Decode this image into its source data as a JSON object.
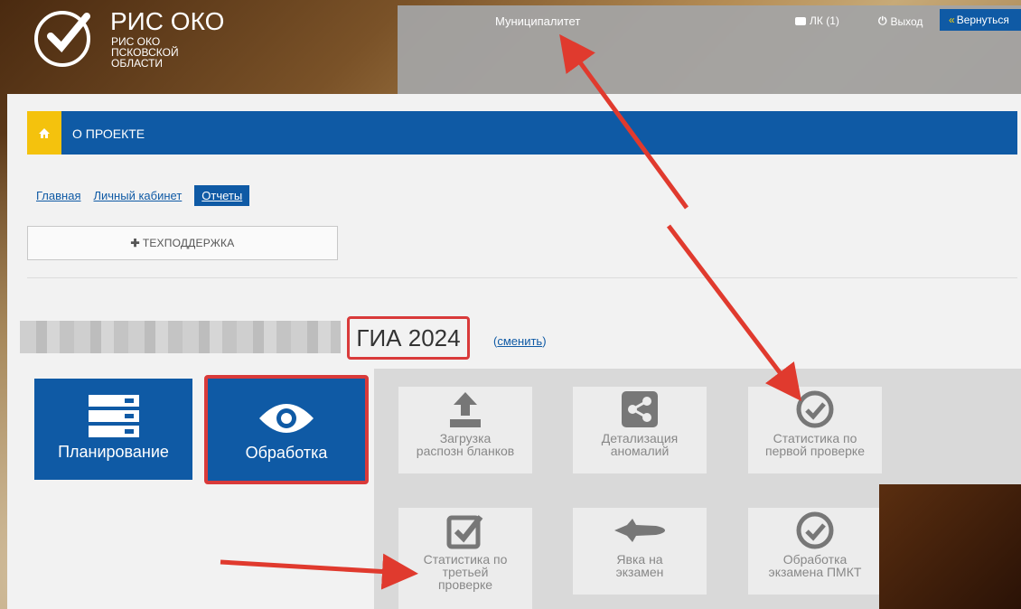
{
  "brand": {
    "title": "РИС ОКО",
    "sub_line1": "РИС ОКО",
    "sub_line2": "ПСКОВСКОЙ",
    "sub_line3": "ОБЛАСТИ"
  },
  "header": {
    "role": "Муниципалитет",
    "lk_label": "ЛК (1)",
    "exit_label": "Выход",
    "back_label": "Вернуться"
  },
  "menu": {
    "label": "О ПРОЕКТЕ"
  },
  "breadcrumbs": [
    {
      "label": "Главная"
    },
    {
      "label": "Личный кабинет"
    },
    {
      "label": "Отчеты"
    }
  ],
  "support": {
    "label": "ТЕХПОДДЕРЖКА"
  },
  "exam": {
    "name": "ГИА 2024",
    "change_link": "сменить"
  },
  "tiles": [
    {
      "label": "Планирование",
      "icon": "server-icon"
    },
    {
      "label": "Обработка",
      "icon": "eye-icon"
    }
  ],
  "cards": [
    {
      "line1": "Загрузка",
      "line2": "распозн бланков",
      "icon": "upload-icon"
    },
    {
      "line1": "Детализация",
      "line2": "аномалий",
      "icon": "share-icon"
    },
    {
      "line1": "Статистика по",
      "line2": "первой проверке",
      "icon": "check-circle-icon"
    },
    {
      "line1": "Статистика по",
      "line2": "третьей",
      "line3": "проверке",
      "icon": "check-square-icon"
    },
    {
      "line1": "Явка на",
      "line2": "экзамен",
      "icon": "shuttle-icon"
    },
    {
      "line1": "Обработка",
      "line2": "экзамена ПМКТ",
      "icon": "check-circle-icon"
    }
  ],
  "colors": {
    "primary": "#0f5aa5",
    "accent_yellow": "#f4c20d",
    "highlight_red": "#d93a3a"
  }
}
